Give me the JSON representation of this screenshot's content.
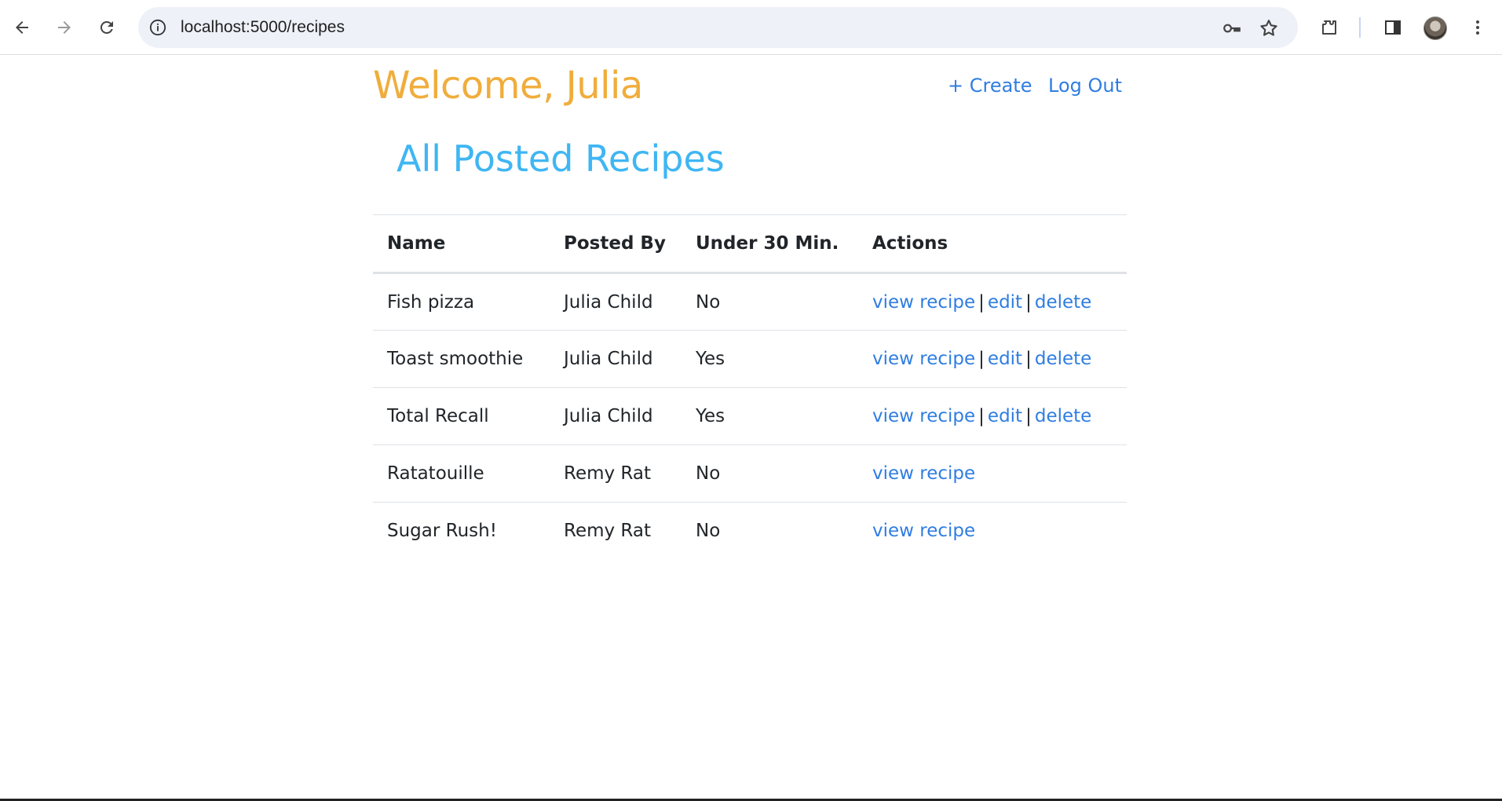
{
  "browser": {
    "url": "localhost:5000/recipes",
    "icons": [
      "back-icon",
      "forward-icon",
      "reload-icon",
      "info-icon",
      "key-icon",
      "star-icon",
      "extensions-icon",
      "side-panel-icon",
      "profile-avatar",
      "more-menu-icon"
    ]
  },
  "header": {
    "welcome": "Welcome, Julia",
    "create_label": "+ Create",
    "logout_label": "Log Out"
  },
  "main": {
    "title": "All Posted Recipes",
    "columns": [
      "Name",
      "Posted By",
      "Under 30 Min.",
      "Actions"
    ],
    "rows": [
      {
        "name": "Fish pizza",
        "posted_by": "Julia Child",
        "under_30": "No",
        "view": "view recipe",
        "edit": "edit",
        "delete": "delete"
      },
      {
        "name": "Toast smoothie",
        "posted_by": "Julia Child",
        "under_30": "Yes",
        "view": "view recipe",
        "edit": "edit",
        "delete": "delete"
      },
      {
        "name": "Total Recall",
        "posted_by": "Julia Child",
        "under_30": "Yes",
        "view": "view recipe",
        "edit": "edit",
        "delete": "delete"
      },
      {
        "name": "Ratatouille",
        "posted_by": "Remy Rat",
        "under_30": "No",
        "view": "view recipe"
      },
      {
        "name": "Sugar Rush!",
        "posted_by": "Remy Rat",
        "under_30": "No",
        "view": "view recipe"
      }
    ],
    "separator": "|"
  },
  "colors": {
    "welcome": "#f0ad3c",
    "title": "#3fb6f3",
    "link": "#2f7de1"
  }
}
